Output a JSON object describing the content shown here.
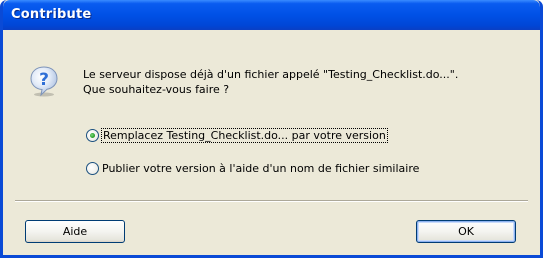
{
  "window": {
    "title": "Contribute"
  },
  "message": {
    "line1": "Le serveur dispose déjà d'un fichier appelé \"Testing_Checklist.do...\".",
    "line2": "Que souhaitez-vous faire ?"
  },
  "icon": {
    "name": "question-icon",
    "color": "#2f6fd6"
  },
  "options": [
    {
      "label": "Remplacez Testing_Checklist.do... par votre version",
      "selected": true
    },
    {
      "label": "Publier votre version à l'aide d'un nom de fichier similaire",
      "selected": false
    }
  ],
  "buttons": {
    "help_label": "Aide",
    "ok_label": "OK"
  },
  "colors": {
    "titlebar": "#0051e6",
    "dialog_bg": "#ece9d8",
    "title_text": "#ffffff"
  }
}
